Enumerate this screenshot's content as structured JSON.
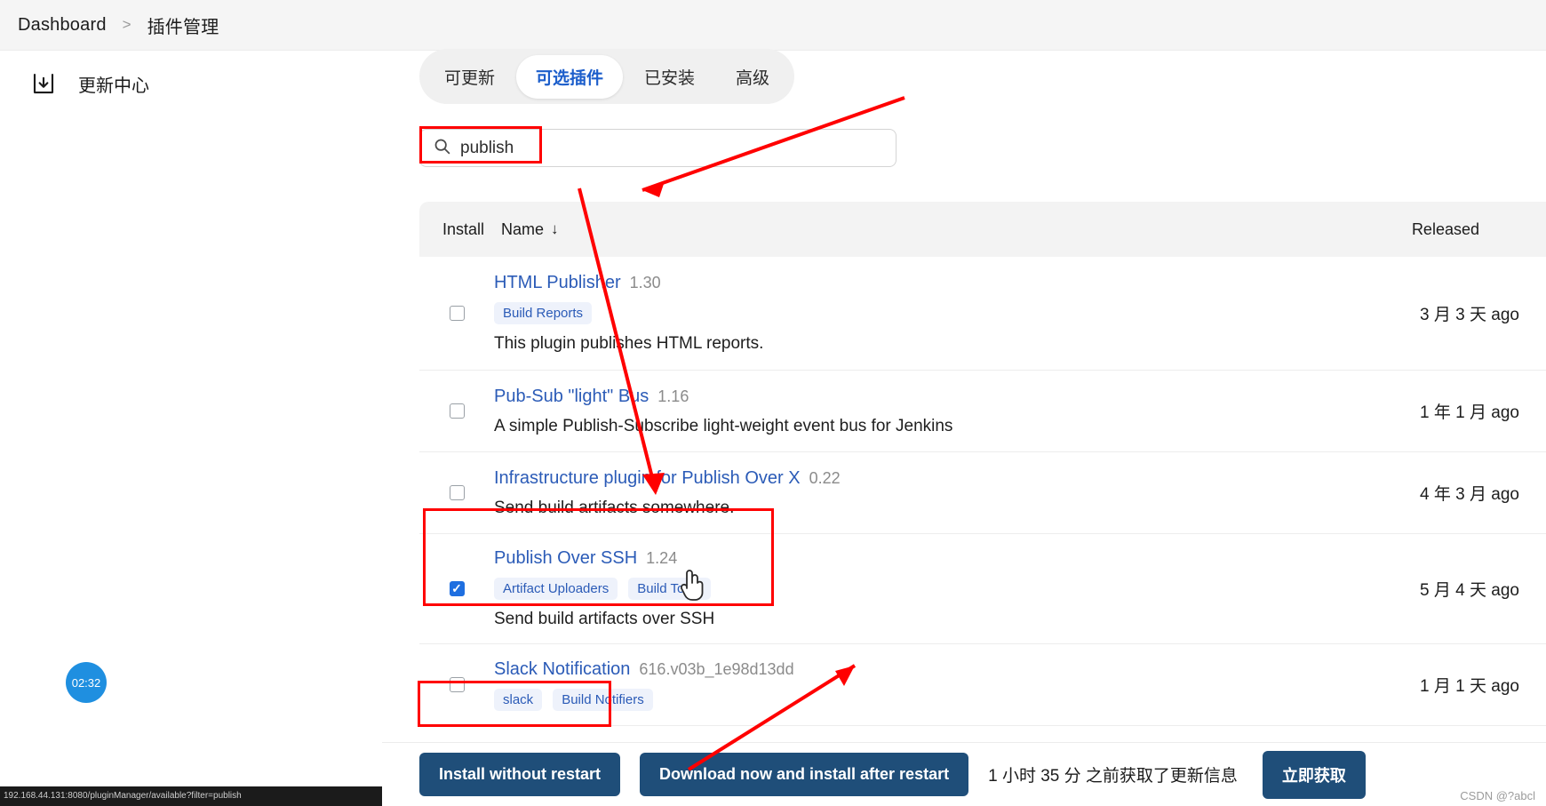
{
  "breadcrumb": {
    "root": "Dashboard",
    "separator": ">",
    "current": "插件管理"
  },
  "sidebar": {
    "items": [
      {
        "label": "更新中心",
        "icon": "download-icon"
      }
    ]
  },
  "tabs": [
    {
      "label": "可更新",
      "active": false
    },
    {
      "label": "可选插件",
      "active": true
    },
    {
      "label": "已安装",
      "active": false
    },
    {
      "label": "高级",
      "active": false
    }
  ],
  "search": {
    "value": "publish",
    "placeholder": "",
    "icon": "search-icon"
  },
  "table": {
    "headers": {
      "install": "Install",
      "name": "Name",
      "sort_arrow": "↓",
      "released": "Released"
    },
    "rows": [
      {
        "checked": false,
        "name": "HTML Publisher",
        "version": "1.30",
        "tags": [
          "Build Reports"
        ],
        "description": "This plugin publishes HTML reports.",
        "released": "3 月 3 天 ago"
      },
      {
        "checked": false,
        "name": "Pub-Sub \"light\" Bus",
        "version": "1.16",
        "tags": [],
        "description": "A simple Publish-Subscribe light-weight event bus for Jenkins",
        "released": "1 年 1 月 ago"
      },
      {
        "checked": false,
        "name": "Infrastructure plugin for Publish Over X",
        "version": "0.22",
        "tags": [],
        "description": "Send build artifacts somewhere.",
        "released": "4 年 3 月 ago"
      },
      {
        "checked": true,
        "name": "Publish Over SSH",
        "version": "1.24",
        "tags": [
          "Artifact Uploaders",
          "Build Tools"
        ],
        "description": "Send build artifacts over SSH",
        "released": "5 月 4 天 ago"
      },
      {
        "checked": false,
        "name": "Slack Notification",
        "version": "616.v03b_1e98d13dd",
        "tags": [
          "slack",
          "Build Notifiers"
        ],
        "description": "",
        "released": "1 月 1 天 ago"
      }
    ]
  },
  "footer": {
    "install_without_restart": "Install without restart",
    "download_install_after_restart": "Download now and install after restart",
    "update_note": "1 小时 35 分 之前获取了更新信息",
    "get_now": "立即获取"
  },
  "overlay": {
    "timer": "02:32",
    "watermark": "CSDN @?abcl",
    "status_strip": "192.168.44.131:8080/pluginManager/available?filter=publish"
  },
  "colors": {
    "accent_blue": "#1c5ecb",
    "link_blue": "#2b5bb7",
    "button_navy": "#1f4e79",
    "annotation_red": "#ff0000",
    "checkbox_blue": "#1f6fe0",
    "header_gray": "#f3f3f3"
  }
}
